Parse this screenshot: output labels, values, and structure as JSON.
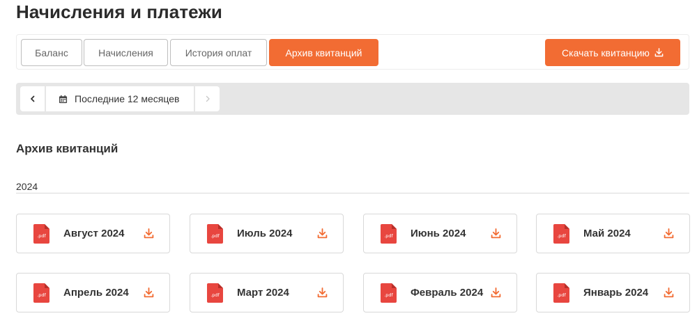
{
  "page": {
    "title": "Начисления и платежи"
  },
  "tabs": [
    {
      "label": "Баланс",
      "active": false
    },
    {
      "label": "Начисления",
      "active": false
    },
    {
      "label": "История оплат",
      "active": false
    },
    {
      "label": "Архив квитанций",
      "active": true
    }
  ],
  "toolbar": {
    "download_label": "Скачать квитанцию",
    "download_icon": "download-icon"
  },
  "period": {
    "label": "Последние 12 месяцев",
    "icon": "calendar-icon",
    "prev_icon": "chevron-left-icon",
    "next_icon": "chevron-right-icon"
  },
  "archive": {
    "title": "Архив квитанций",
    "year": "2024",
    "items": [
      {
        "label": "Август 2024",
        "badge": ".pdf"
      },
      {
        "label": "Июль 2024",
        "badge": ".pdf"
      },
      {
        "label": "Июнь 2024",
        "badge": ".pdf"
      },
      {
        "label": "Май 2024",
        "badge": ".pdf"
      },
      {
        "label": "Апрель 2024",
        "badge": ".pdf"
      },
      {
        "label": "Март 2024",
        "badge": ".pdf"
      },
      {
        "label": "Февраль 2024",
        "badge": ".pdf"
      },
      {
        "label": "Январь 2024",
        "badge": ".pdf"
      }
    ]
  },
  "colors": {
    "accent": "#f26c33",
    "pdf_red": "#e8463f",
    "border": "#d8d8d8",
    "period_bg": "#e6e6e6"
  }
}
